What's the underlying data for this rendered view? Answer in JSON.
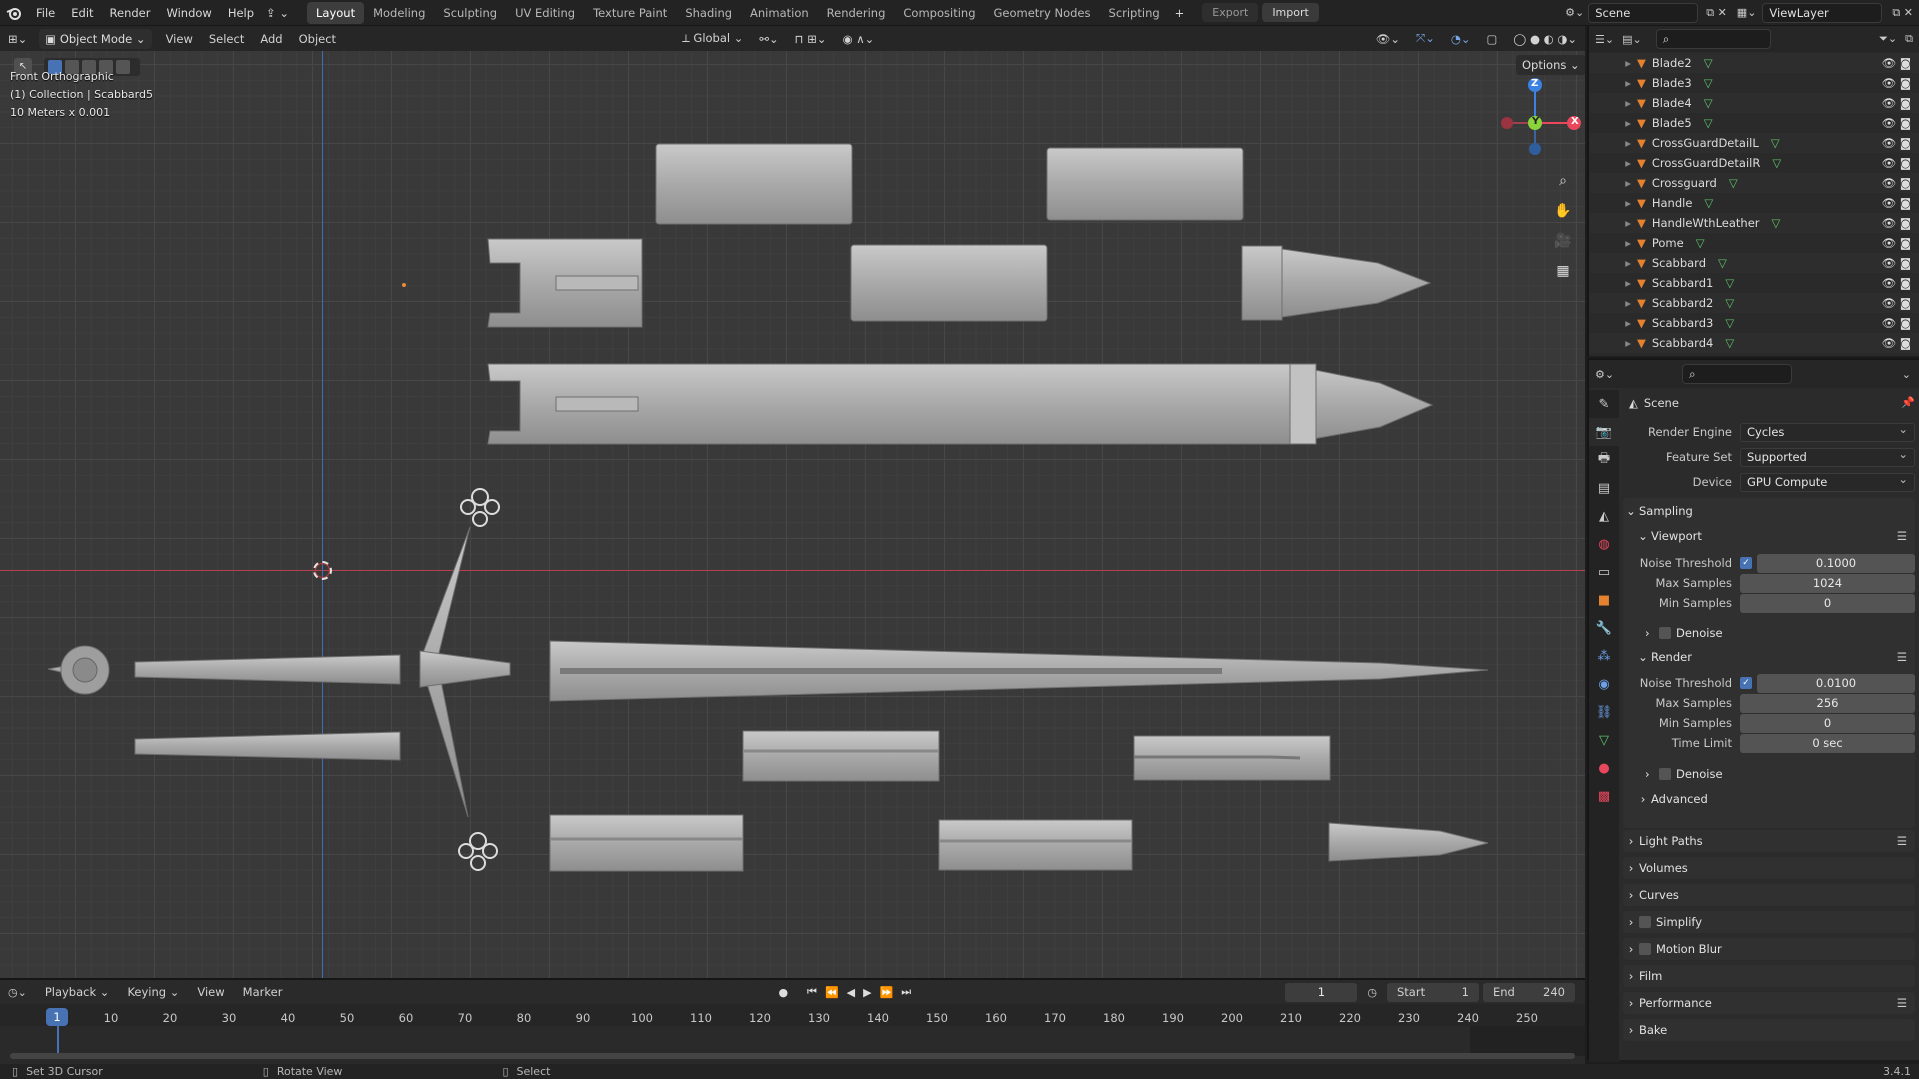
{
  "topbar": {
    "menus": [
      "File",
      "Edit",
      "Render",
      "Window",
      "Help"
    ],
    "workspaces": [
      "Layout",
      "Modeling",
      "Sculpting",
      "UV Editing",
      "Texture Paint",
      "Shading",
      "Animation",
      "Rendering",
      "Compositing",
      "Geometry Nodes",
      "Scripting"
    ],
    "active_workspace": "Layout",
    "export_label": "Export",
    "import_label": "Import",
    "scene_name": "Scene",
    "viewlayer_name": "ViewLayer"
  },
  "viewport_header": {
    "mode": "Object Mode",
    "menus": [
      "View",
      "Select",
      "Add",
      "Object"
    ],
    "orientation": "Global",
    "options_label": "Options"
  },
  "viewport_info": {
    "view_name": "Front Orthographic",
    "collection": "(1) Collection | Scabbard5",
    "scale": "10 Meters x 0.001"
  },
  "gizmo": {
    "z": "Z",
    "y": "Y",
    "x": "X"
  },
  "outliner": {
    "items": [
      "Blade2",
      "Blade3",
      "Blade4",
      "Blade5",
      "CrossGuardDetailL",
      "CrossGuardDetailR",
      "Crossguard",
      "Handle",
      "HandleWthLeather",
      "Pome",
      "Scabbard",
      "Scabbard1",
      "Scabbard2",
      "Scabbard3",
      "Scabbard4"
    ]
  },
  "properties": {
    "context": "Scene",
    "render_engine_label": "Render Engine",
    "render_engine": "Cycles",
    "feature_set_label": "Feature Set",
    "feature_set": "Supported",
    "device_label": "Device",
    "device": "GPU Compute",
    "sampling": "Sampling",
    "viewport": "Viewport",
    "noise_threshold_label": "Noise Threshold",
    "vp_noise_threshold": "0.1000",
    "max_samples_label": "Max Samples",
    "vp_max_samples": "1024",
    "min_samples_label": "Min Samples",
    "vp_min_samples": "0",
    "denoise": "Denoise",
    "render": "Render",
    "r_noise_threshold": "0.0100",
    "r_max_samples": "256",
    "r_min_samples": "0",
    "time_limit_label": "Time Limit",
    "r_time_limit": "0 sec",
    "advanced": "Advanced",
    "sections": [
      "Light Paths",
      "Volumes",
      "Curves",
      "Simplify",
      "Motion Blur",
      "Film",
      "Performance",
      "Bake"
    ]
  },
  "timeline": {
    "menus": [
      "Playback",
      "Keying",
      "View",
      "Marker"
    ],
    "current_frame": "1",
    "start_label": "Start",
    "start": "1",
    "end_label": "End",
    "end": "240",
    "ticks": [
      "1",
      "10",
      "20",
      "30",
      "40",
      "50",
      "60",
      "70",
      "80",
      "90",
      "100",
      "110",
      "120",
      "130",
      "140",
      "150",
      "160",
      "170",
      "180",
      "190",
      "200",
      "210",
      "220",
      "230",
      "240",
      "250"
    ]
  },
  "statusbar": {
    "left": "Set 3D Cursor",
    "mid": "Rotate View",
    "right": "Select",
    "version": "3.4.1"
  },
  "colors": {
    "accent": "#4772b3",
    "object_orange": "#e5822f",
    "mesh_green": "#5ec26b",
    "axis_x": "#e8475c",
    "axis_y": "#8bd33b",
    "axis_z": "#3b82e3"
  }
}
